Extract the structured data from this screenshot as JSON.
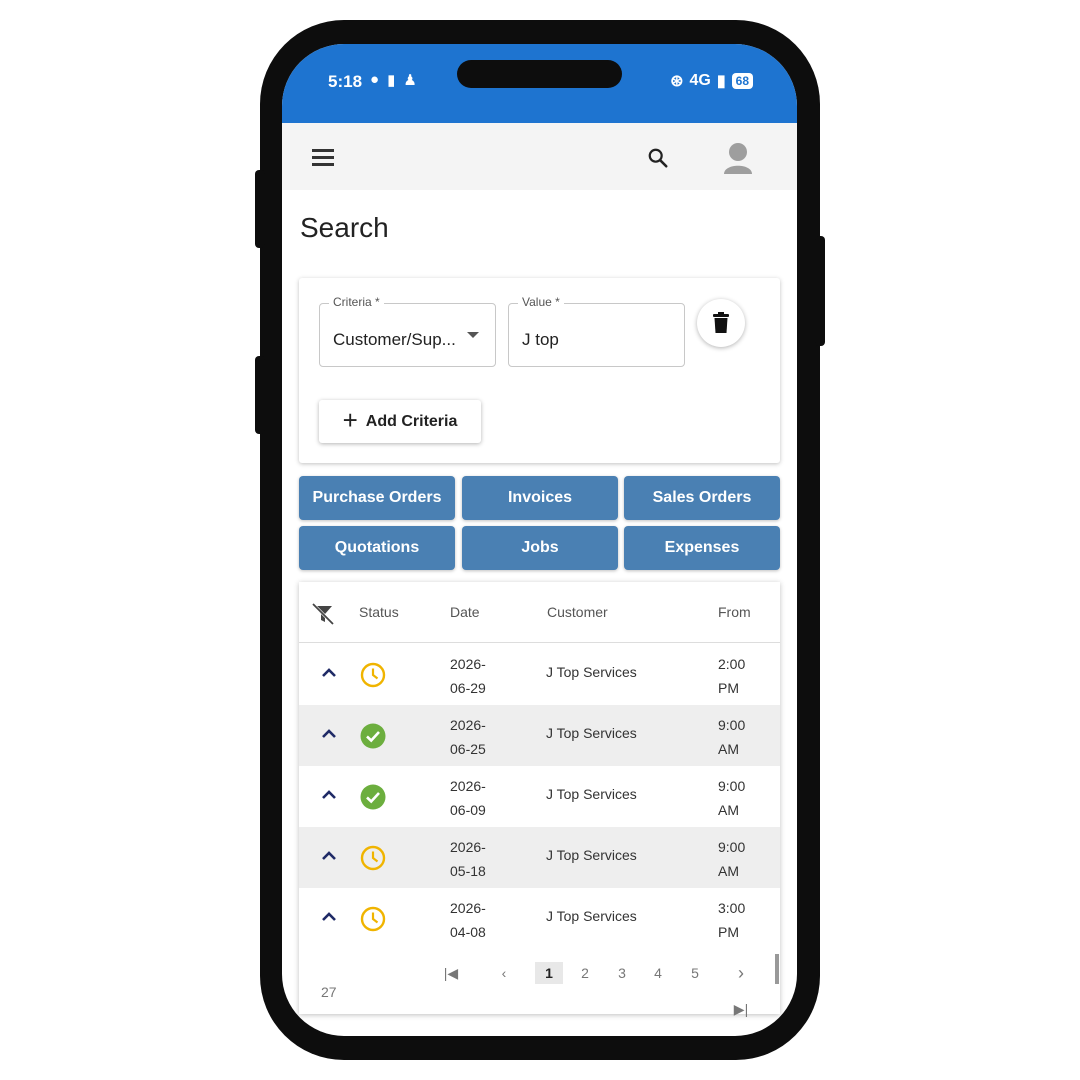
{
  "status_bar": {
    "time": "5:18",
    "network": "4G",
    "battery": "68"
  },
  "app_bar": {
    "menu_icon": "hamburger-menu-icon",
    "search_icon": "search-icon",
    "avatar_icon": "account-avatar-icon"
  },
  "page": {
    "title": "Search"
  },
  "criteria": {
    "criteria_label": "Criteria *",
    "criteria_value": "Customer/Sup...",
    "value_label": "Value *",
    "value_value": "J top",
    "add_label": "Add Criteria"
  },
  "categories": [
    {
      "label": "Purchase Orders"
    },
    {
      "label": "Invoices"
    },
    {
      "label": "Sales Orders"
    },
    {
      "label": "Quotations"
    },
    {
      "label": "Jobs"
    },
    {
      "label": "Expenses"
    }
  ],
  "table": {
    "headers": {
      "status": "Status",
      "date": "Date",
      "customer": "Customer",
      "from": "From"
    },
    "rows": [
      {
        "status": "pending",
        "date_line1": "2026-",
        "date_line2": "06-29",
        "customer": "J Top Services",
        "from_line1": "2:00",
        "from_line2": "PM"
      },
      {
        "status": "done",
        "date_line1": "2026-",
        "date_line2": "06-25",
        "customer": "J Top Services",
        "from_line1": "9:00",
        "from_line2": "AM"
      },
      {
        "status": "done",
        "date_line1": "2026-",
        "date_line2": "06-09",
        "customer": "J Top Services",
        "from_line1": "9:00",
        "from_line2": "AM"
      },
      {
        "status": "pending",
        "date_line1": "2026-",
        "date_line2": "05-18",
        "customer": "J Top Services",
        "from_line1": "9:00",
        "from_line2": "AM"
      },
      {
        "status": "pending",
        "date_line1": "2026-",
        "date_line2": "04-08",
        "customer": "J Top Services",
        "from_line1": "3:00",
        "from_line2": "PM"
      }
    ]
  },
  "pagination": {
    "pages": [
      "1",
      "2",
      "3",
      "4",
      "5"
    ],
    "current": "1",
    "total": "27"
  },
  "colors": {
    "status_bar": "#1e74d0",
    "category_button": "#4a80b3",
    "pending": "#f0b400",
    "done": "#6cae3e",
    "chevron": "#1f2a66"
  }
}
